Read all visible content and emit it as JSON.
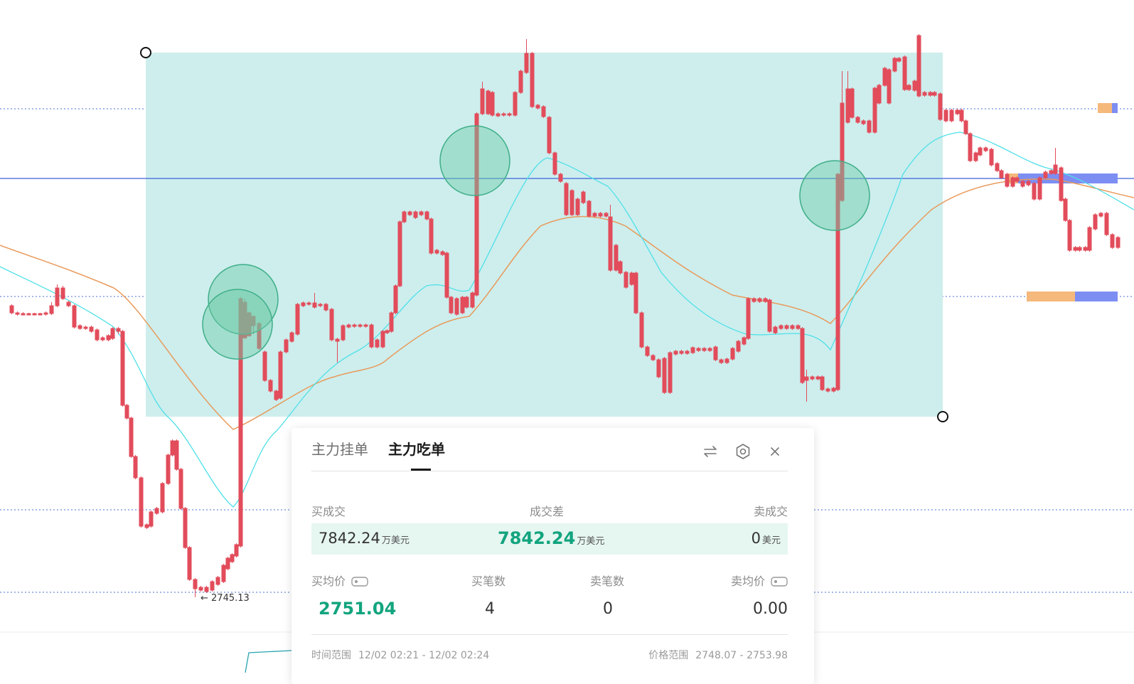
{
  "chart": {
    "low_label": "← 2745.13",
    "colors": {
      "up": "#1aa885",
      "down": "#e24c5b",
      "ma_fast": "#4fe0e8",
      "ma_slow": "#e9995a",
      "highlight_box": "#cdeeed",
      "current_price_line": "#3c63d8",
      "marker_orange": "#f5b97b",
      "marker_blue": "#7d8ef3"
    }
  },
  "panel": {
    "tabs": [
      "主力挂单",
      "主力吃单"
    ],
    "active_tab": "主力吃单",
    "icons": [
      "swap-icon",
      "gear-icon",
      "close-icon"
    ],
    "summary": {
      "buy_label": "买成交",
      "diff_label": "成交差",
      "sell_label": "卖成交",
      "buy_value": "7842.24",
      "buy_unit": "万美元",
      "diff_value": "7842.24",
      "diff_unit": "万美元",
      "sell_value": "0",
      "sell_unit": "美元"
    },
    "stats": {
      "buy_avg_label": "买均价",
      "buy_count_label": "买笔数",
      "sell_count_label": "卖笔数",
      "sell_avg_label": "卖均价",
      "buy_avg": "2751.04",
      "buy_count": "4",
      "sell_count": "0",
      "sell_avg": "0.00"
    },
    "footer": {
      "time_label": "时间范围",
      "time_value": "12/02 02:21 - 12/02 02:24",
      "price_label": "价格范围",
      "price_value": "2748.07 - 2753.98"
    }
  }
}
